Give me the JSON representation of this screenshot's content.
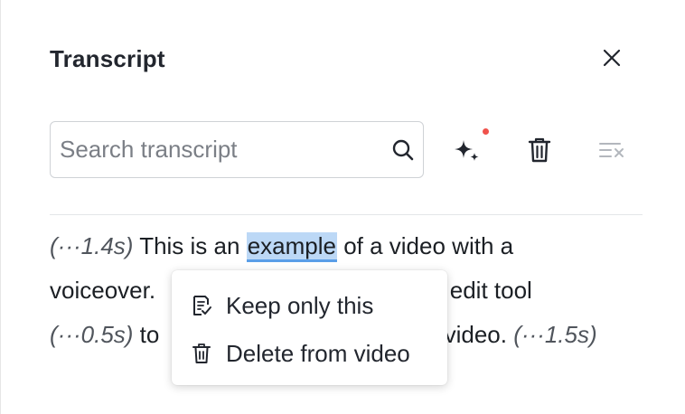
{
  "panel": {
    "title": "Transcript",
    "close_icon": "close-icon"
  },
  "search": {
    "placeholder": "Search transcript",
    "value": "",
    "icon": "search-icon"
  },
  "toolbar": {
    "ai_icon": "sparkles-icon",
    "trash_icon": "trash-icon",
    "clear_icon": "clear-format-icon",
    "notification_color": "#f0524c"
  },
  "transcript": {
    "line1": {
      "pause": "(···1.4s)",
      "before": " This is an ",
      "highlight": "example",
      "after": " of a video with a"
    },
    "line2": {
      "start": "voiceover.",
      "end": "e edit tool"
    },
    "line3": {
      "pause_start": "(···0.5s)",
      "start": " to ",
      "end": "video.",
      "pause_end": "(···1.5s)"
    },
    "highlight_color": "#bcd8f6"
  },
  "context_menu": {
    "items": [
      {
        "label": "Keep only this",
        "icon": "keep-only-icon"
      },
      {
        "label": "Delete from video",
        "icon": "trash-icon"
      }
    ]
  }
}
